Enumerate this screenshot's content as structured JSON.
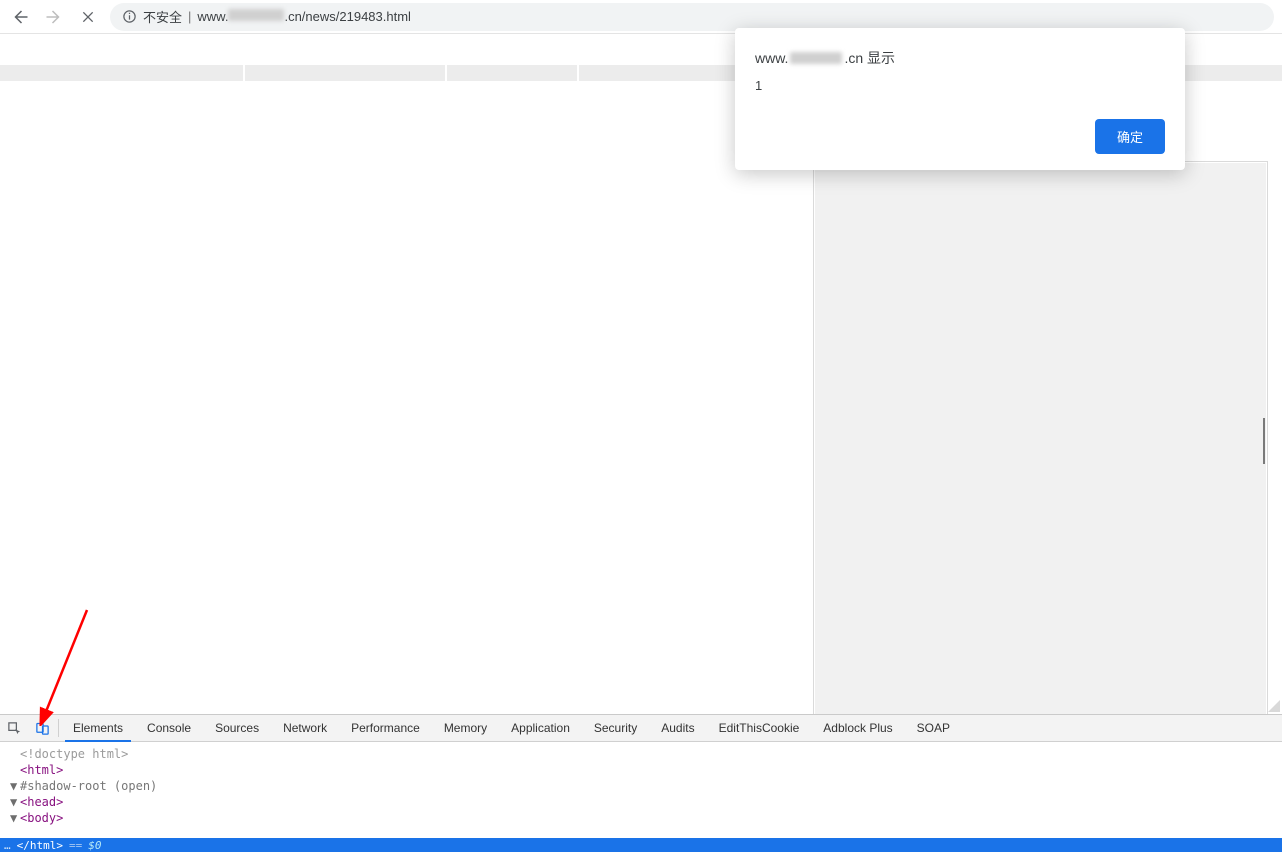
{
  "browser": {
    "security_label": "不安全",
    "url_prefix": "www.",
    "url_suffix": ".cn/news/219483.html"
  },
  "alert": {
    "origin_prefix": "www.",
    "origin_suffix": ".cn 显示",
    "message": "1",
    "ok_label": "确定"
  },
  "devtools": {
    "tabs": [
      "Elements",
      "Console",
      "Sources",
      "Network",
      "Performance",
      "Memory",
      "Application",
      "Security",
      "Audits",
      "EditThisCookie",
      "Adblock Plus",
      "SOAP"
    ],
    "active_tab": "Elements",
    "elements_lines": [
      {
        "caret": "",
        "cls": "tok-doctype",
        "text": "<!doctype html>"
      },
      {
        "caret": "",
        "cls": "tok-tag",
        "text": "<html>"
      },
      {
        "caret": "▼",
        "cls": "tok-shadow",
        "text": "#shadow-root (open)"
      },
      {
        "caret": "▼",
        "cls": "tok-tag",
        "text": "<head>"
      },
      {
        "caret": "▼",
        "cls": "tok-tag",
        "text": "<body>"
      }
    ],
    "status_dots": "…",
    "status_closing": "</html>",
    "status_eq": "==",
    "status_dollar": "$0"
  }
}
